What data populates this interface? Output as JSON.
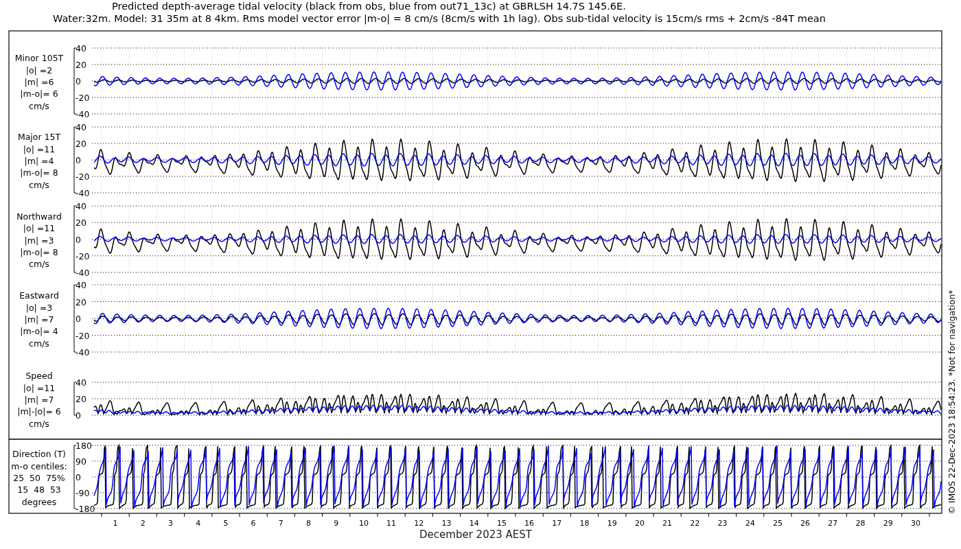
{
  "title": [
    "Predicted depth-average tidal velocity (black from obs, blue from out71_13c) at GBRLSH 14.7S 145.6E.",
    "Water:32m. Model: 31 35m at 8 4km. Rms model vector error |m-o| = 8 cm/s (8cm/s with 1h lag). Obs sub-tidal velocity is 15cm/s rms + 2cm/s -84T mean"
  ],
  "panels": [
    {
      "kind": "minor",
      "label": [
        "Minor 105T",
        "|o| =2",
        "|m| =6",
        "|m-o|= 6",
        "cm/s"
      ],
      "yticks": [
        "40",
        "20",
        "0",
        "-20",
        "-40"
      ]
    },
    {
      "kind": "major",
      "label": [
        "Major 15T",
        "|o| =11",
        "|m| =4",
        "|m-o|= 8",
        "cm/s"
      ],
      "yticks": [
        "40",
        "20",
        "0",
        "-20",
        "-40"
      ]
    },
    {
      "kind": "north",
      "label": [
        "Northward",
        "|o| =11",
        "|m| =3",
        "|m-o|= 8",
        "cm/s"
      ],
      "yticks": [
        "40",
        "20",
        "0",
        "-20",
        "-40"
      ]
    },
    {
      "kind": "east",
      "label": [
        "Eastward",
        "|o| =3",
        "|m| =7",
        "|m-o|= 4",
        "cm/s"
      ],
      "yticks": [
        "40",
        "20",
        "0",
        "-20",
        "-40"
      ]
    },
    {
      "kind": "speed",
      "label": [
        "Speed",
        "|o| =11",
        "|m| =7",
        "|m|-|o|= 6",
        "cm/s"
      ],
      "yticks": [
        "40",
        "20",
        "0"
      ]
    },
    {
      "kind": "direction",
      "label": [
        "Direction (T)",
        "m-o centiles:",
        "25  50  75%",
        "15  48  53",
        "degrees"
      ],
      "yticks": [
        "180",
        "90",
        "0",
        "-90",
        "-180"
      ]
    }
  ],
  "xticks": [
    "1",
    "2",
    "3",
    "4",
    "5",
    "6",
    "7",
    "8",
    "9",
    "10",
    "11",
    "12",
    "13",
    "14",
    "15",
    "16",
    "17",
    "18",
    "19",
    "20",
    "21",
    "22",
    "23",
    "24",
    "25",
    "26",
    "27",
    "28",
    "29",
    "30"
  ],
  "xlabel": "December 2023 AEST",
  "credit": "© IMOS 22-Dec-2023 18:54:23. *Not for navigation*"
}
